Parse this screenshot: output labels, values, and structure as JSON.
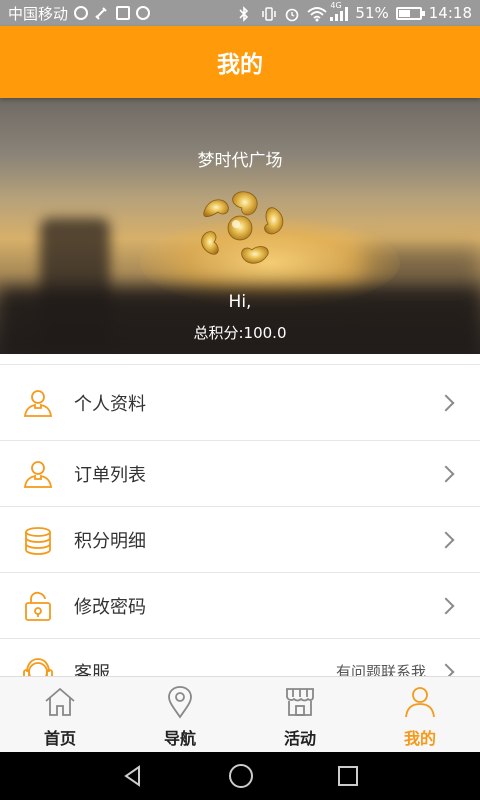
{
  "status_bar": {
    "carrier": "中国移动",
    "network": "4G",
    "battery_percent": "51%",
    "battery_level": 0.51,
    "time": "14:18",
    "icons": [
      "notification-icon",
      "usb-icon",
      "image-icon",
      "app-icon",
      "bluetooth-icon",
      "vibrate-icon",
      "alarm-icon",
      "wifi-icon",
      "signal-icon",
      "battery-icon"
    ]
  },
  "header": {
    "title": "我的"
  },
  "profile": {
    "mall_name": "梦时代广场",
    "greeting": "Hi,",
    "points_text": "总积分:100.0"
  },
  "menu": {
    "items": [
      {
        "label": "个人资料",
        "icon": "person-icon",
        "extra": ""
      },
      {
        "label": "订单列表",
        "icon": "order-person-icon",
        "extra": ""
      },
      {
        "label": "积分明细",
        "icon": "coins-icon",
        "extra": ""
      },
      {
        "label": "修改密码",
        "icon": "lock-icon",
        "extra": ""
      },
      {
        "label": "客服",
        "icon": "customer-service-icon",
        "extra": "有问题联系我"
      }
    ]
  },
  "tabbar": {
    "tabs": [
      {
        "label": "首页",
        "icon": "home-icon",
        "active": false
      },
      {
        "label": "导航",
        "icon": "location-pin-icon",
        "active": false
      },
      {
        "label": "活动",
        "icon": "store-icon",
        "active": false
      },
      {
        "label": "我的",
        "icon": "user-icon",
        "active": true
      }
    ]
  },
  "colors": {
    "accent": "#ff9a0a",
    "icon_orange": "#f59a1b",
    "text": "#333333"
  }
}
